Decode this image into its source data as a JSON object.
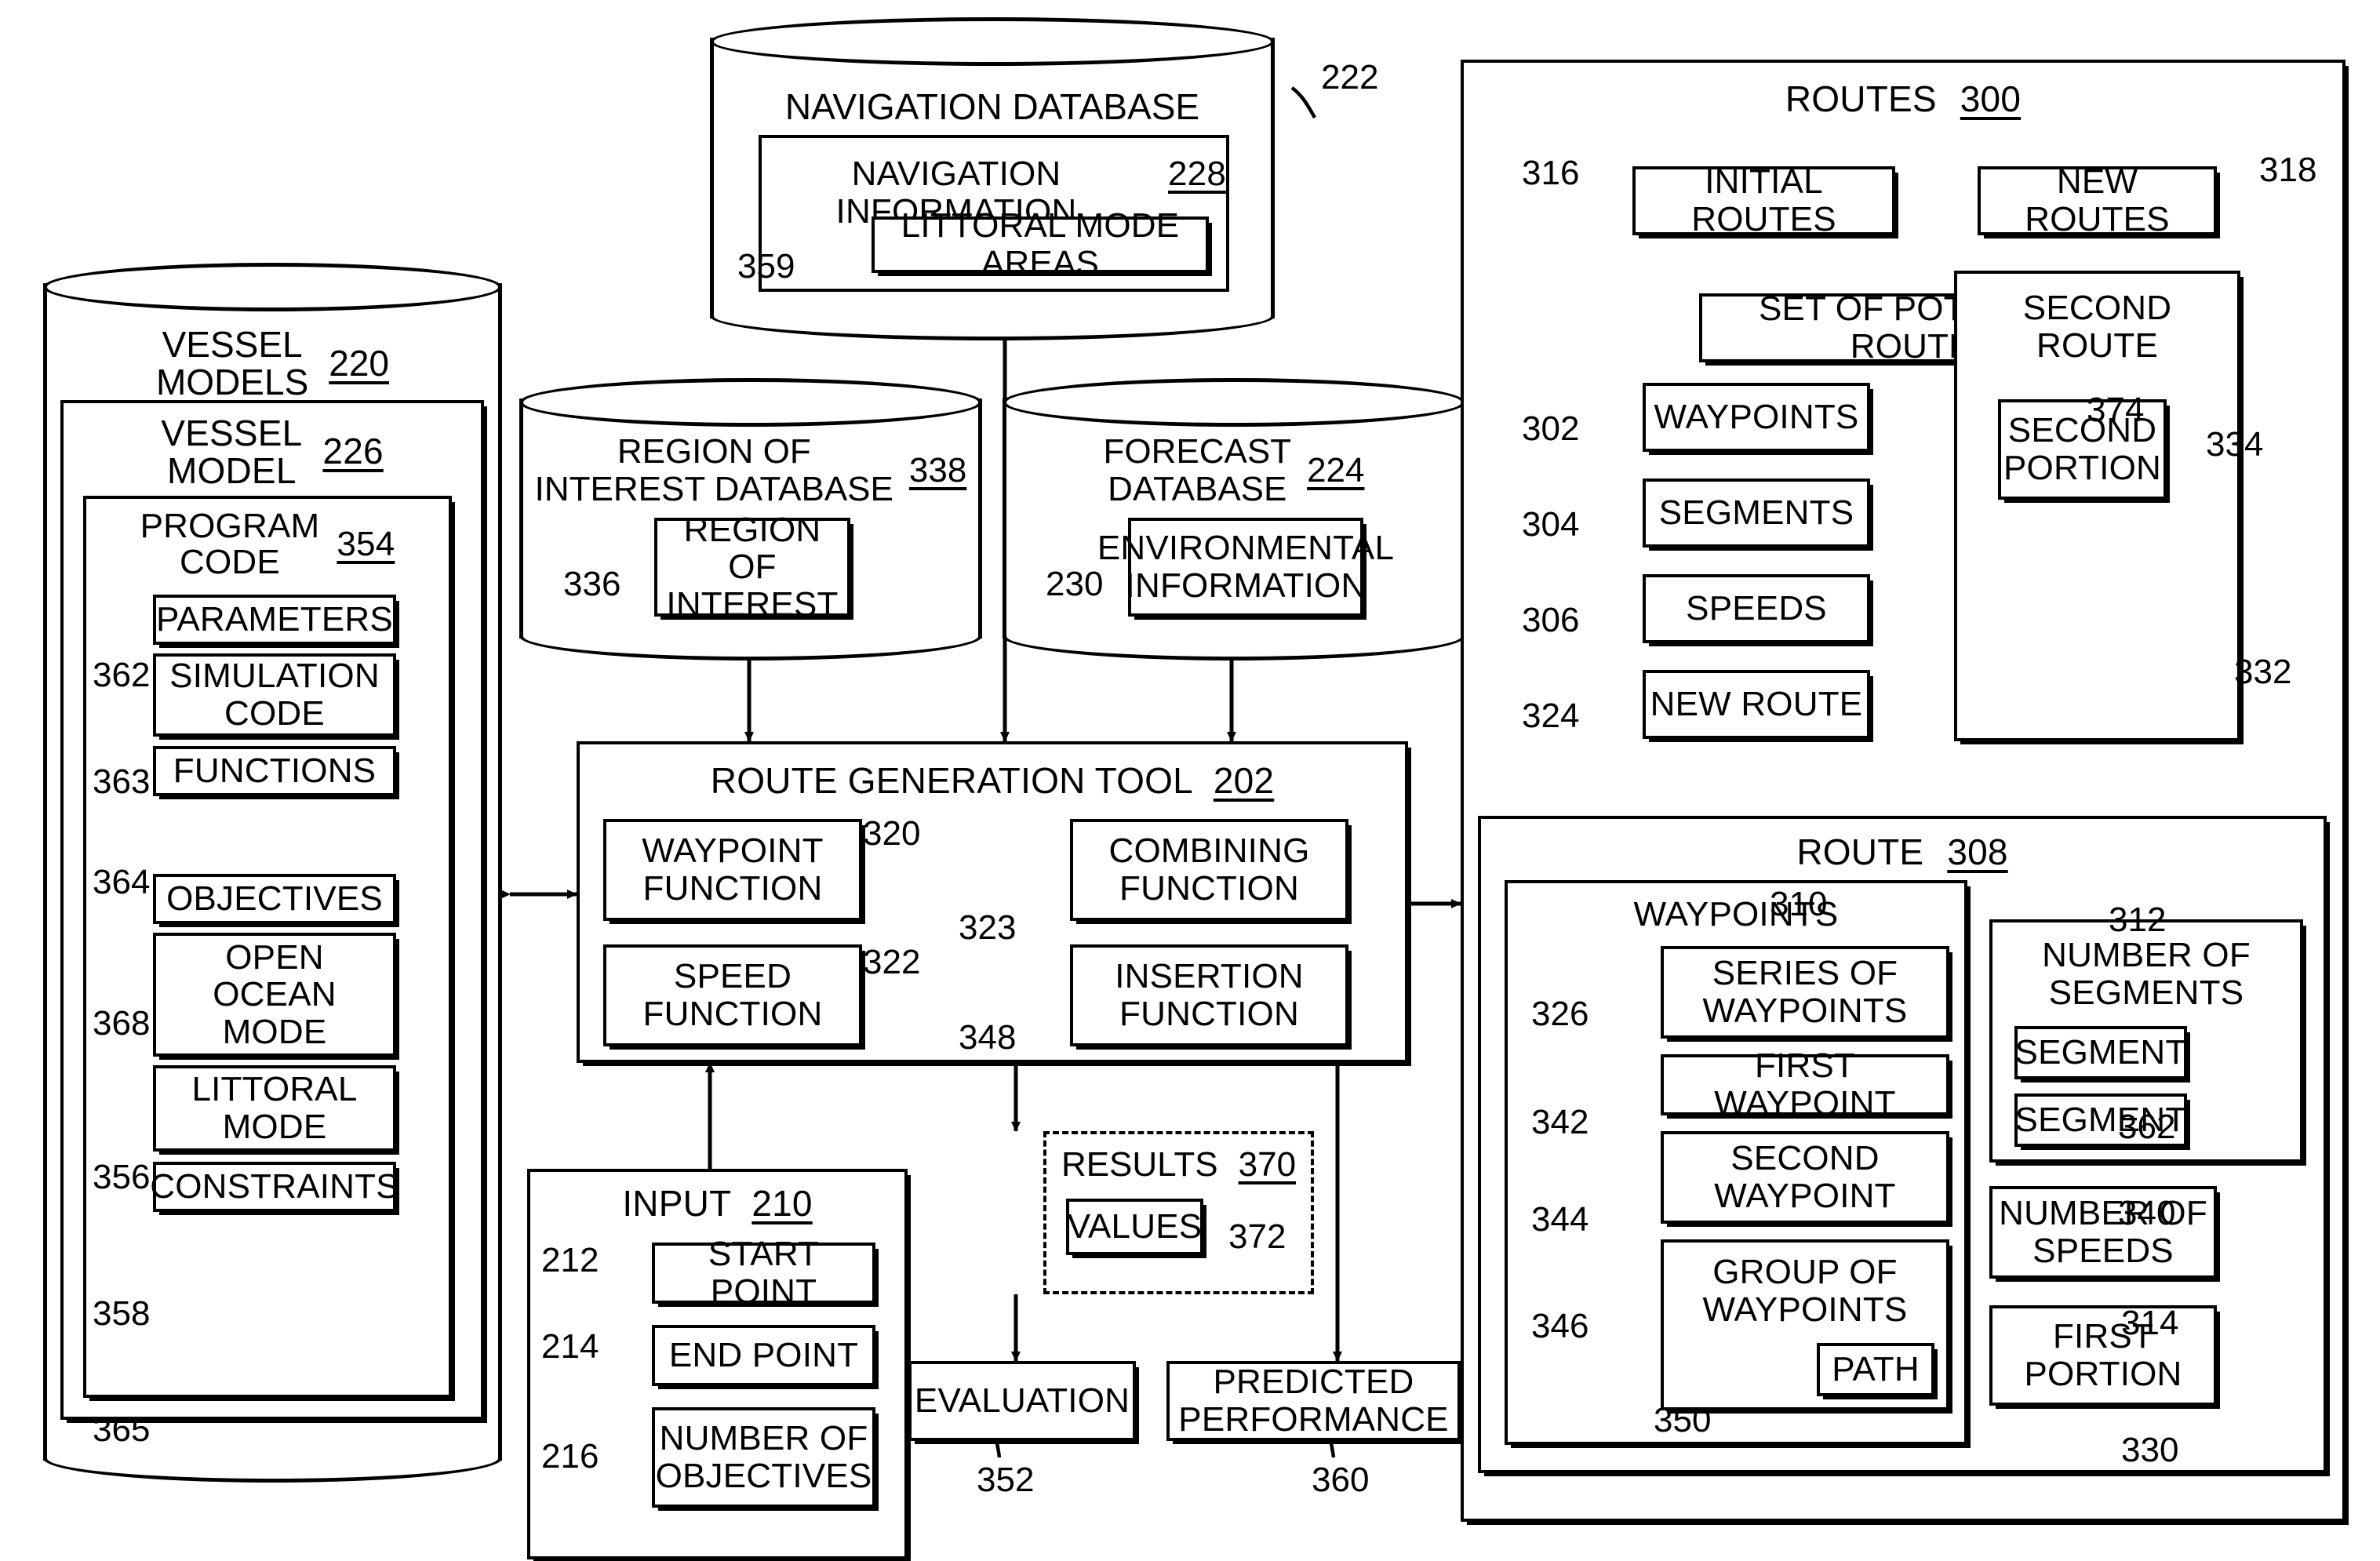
{
  "figure": {
    "databases": {
      "navigation": {
        "title": "NAVIGATION DATABASE",
        "ref": "222",
        "inner_title": "NAVIGATION INFORMATION",
        "inner_ref": "228",
        "item": "LITTORAL MODE AREAS",
        "item_ref": "359"
      },
      "vessel_models": {
        "title_line1": "VESSEL",
        "title_line2": "MODELS",
        "ref": "220",
        "vessel_model": {
          "title_line1": "VESSEL",
          "title_line2": "MODEL",
          "ref": "226",
          "program_code": {
            "title_line1": "PROGRAM",
            "title_line2": "CODE",
            "ref": "354",
            "items": [
              {
                "label": "PARAMETERS",
                "ref": "362"
              },
              {
                "label": "SIMULATION CODE",
                "ref": "363"
              },
              {
                "label": "FUNCTIONS",
                "ref": "364"
              },
              {
                "label": "OBJECTIVES",
                "ref": "368"
              },
              {
                "label": "OPEN OCEAN MODE",
                "ref": "356"
              },
              {
                "label": "LITTORAL MODE",
                "ref": "358"
              },
              {
                "label": "CONSTRAINTS",
                "ref": "365"
              }
            ]
          }
        }
      },
      "region_of_interest": {
        "title_line1": "REGION OF",
        "title_line2": "INTEREST DATABASE",
        "ref": "338",
        "item_line1": "REGION OF",
        "item_line2": "INTEREST",
        "item_ref": "336"
      },
      "forecast": {
        "title_line1": "FORECAST",
        "title_line2": "DATABASE",
        "ref": "224",
        "item_line1": "ENVIRONMENTAL",
        "item_line2": "INFORMATION",
        "item_ref": "230"
      }
    },
    "route_generation_tool": {
      "title": "ROUTE GENERATION TOOL",
      "ref": "202",
      "functions": [
        {
          "line1": "WAYPOINT",
          "line2": "FUNCTION",
          "ref": "320"
        },
        {
          "line1": "COMBINING",
          "line2": "FUNCTION",
          "ref": "323"
        },
        {
          "line1": "SPEED FUNCTION",
          "line2": "",
          "ref": "322"
        },
        {
          "line1": "INSERTION",
          "line2": "FUNCTION",
          "ref": "348"
        }
      ]
    },
    "input": {
      "title": "INPUT",
      "ref": "210",
      "items": [
        {
          "label": "START POINT",
          "ref": "212"
        },
        {
          "label": "END POINT",
          "ref": "214"
        },
        {
          "label": "NUMBER OF OBJECTIVES",
          "ref": "216"
        }
      ]
    },
    "results": {
      "title": "RESULTS",
      "ref": "370",
      "values_label": "VALUES",
      "values_ref": "372"
    },
    "outputs": [
      {
        "label": "EVALUATION",
        "ref": "352"
      },
      {
        "label": "PREDICTED PERFORMANCE",
        "ref": "360"
      }
    ],
    "routes_panel": {
      "title": "ROUTES",
      "ref": "300",
      "initial_routes": {
        "label": "INITIAL ROUTES",
        "ref": "316"
      },
      "new_routes": {
        "label": "NEW ROUTES",
        "ref": "318"
      },
      "set_of_potential_routes": {
        "label": "SET OF POTENTIAL ROUTES",
        "ref": "374"
      },
      "side_items": [
        {
          "label": "WAYPOINTS",
          "ref": "302"
        },
        {
          "label": "SEGMENTS",
          "ref": "304"
        },
        {
          "label": "SPEEDS",
          "ref": "306"
        },
        {
          "label": "NEW ROUTE",
          "ref": "324"
        }
      ],
      "second_route": {
        "title_line1": "SECOND",
        "title_line2": "ROUTE",
        "ref": "334",
        "inner_line1": "SECOND",
        "inner_line2": "PORTION",
        "inner_ref": "332"
      },
      "route": {
        "title": "ROUTE",
        "ref": "308",
        "waypoints": {
          "title": "WAYPOINTS",
          "ref": "310",
          "items": [
            {
              "line1": "SERIES OF",
              "line2": "WAYPOINTS",
              "ref": "326"
            },
            {
              "line1": "FIRST WAYPOINT",
              "line2": "",
              "ref": "342"
            },
            {
              "line1": "SECOND",
              "line2": "WAYPOINT",
              "ref": "344"
            },
            {
              "line1": "GROUP OF",
              "line2": "WAYPOINTS",
              "ref": "346"
            }
          ],
          "path": {
            "label": "PATH",
            "ref": "350"
          }
        },
        "segments": {
          "title_line1": "NUMBER OF",
          "title_line2": "SEGMENTS",
          "ref": "312",
          "items": [
            {
              "label": "SEGMENT",
              "ref": "362"
            },
            {
              "label": "SEGMENT",
              "ref": "340"
            }
          ]
        },
        "speeds": {
          "line1": "NUMBER OF",
          "line2": "SPEEDS",
          "ref": "314"
        },
        "first_portion": {
          "line1": "FIRST",
          "line2": "PORTION",
          "ref": "330"
        }
      }
    }
  }
}
